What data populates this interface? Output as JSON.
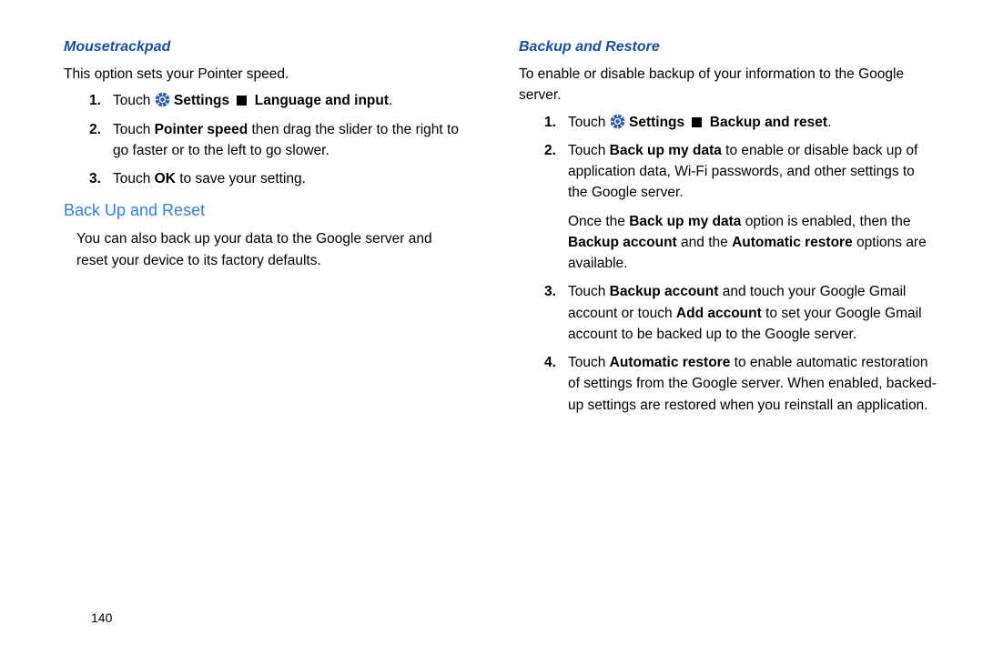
{
  "page_number": "140",
  "left": {
    "heading1": "Mousetrackpad",
    "intro1": "This option sets your Pointer speed.",
    "step1_prefix": "Touch ",
    "step1_settings": "Settings",
    "step1_path": "Language and input",
    "step2_p1": "Touch ",
    "step2_b1": "Pointer speed",
    "step2_p2": " then drag the slider to the right to go faster or to the left to go slower.",
    "step3_p1": "Touch ",
    "step3_b1": "OK",
    "step3_p2": " to save your setting.",
    "heading2": "Back Up and Reset",
    "intro2": "You can also back up your data to the Google server and reset your device to its factory defaults."
  },
  "right": {
    "heading1": "Backup and Restore",
    "intro1": "To enable or disable backup of your information to the Google server.",
    "step1_prefix": "Touch ",
    "step1_settings": "Settings",
    "step1_path": "Backup and reset",
    "step2_p1": "Touch ",
    "step2_b1": "Back up my data",
    "step2_p2": " to enable or disable back up of application data, Wi-Fi passwords, and other settings to the Google server.",
    "step2_follow_p1": "Once the ",
    "step2_follow_b1": "Back up my data",
    "step2_follow_p2": " option is enabled, then the ",
    "step2_follow_b2": "Backup account",
    "step2_follow_p3": " and the ",
    "step2_follow_b3": "Automatic restore",
    "step2_follow_p4": " options are available.",
    "step3_p1": "Touch ",
    "step3_b1": "Backup account",
    "step3_p2": " and touch your Google Gmail account or touch ",
    "step3_b2": "Add account",
    "step3_p3": " to set your Google Gmail account to be backed up to the Google server.",
    "step4_p1": "Touch ",
    "step4_b1": "Automatic restore",
    "step4_p2": " to enable automatic restoration of settings from the Google server. When enabled, backed-up settings are restored when you reinstall an application."
  },
  "nums": {
    "n1": "1.",
    "n2": "2.",
    "n3": "3.",
    "n4": "4."
  },
  "period": "."
}
